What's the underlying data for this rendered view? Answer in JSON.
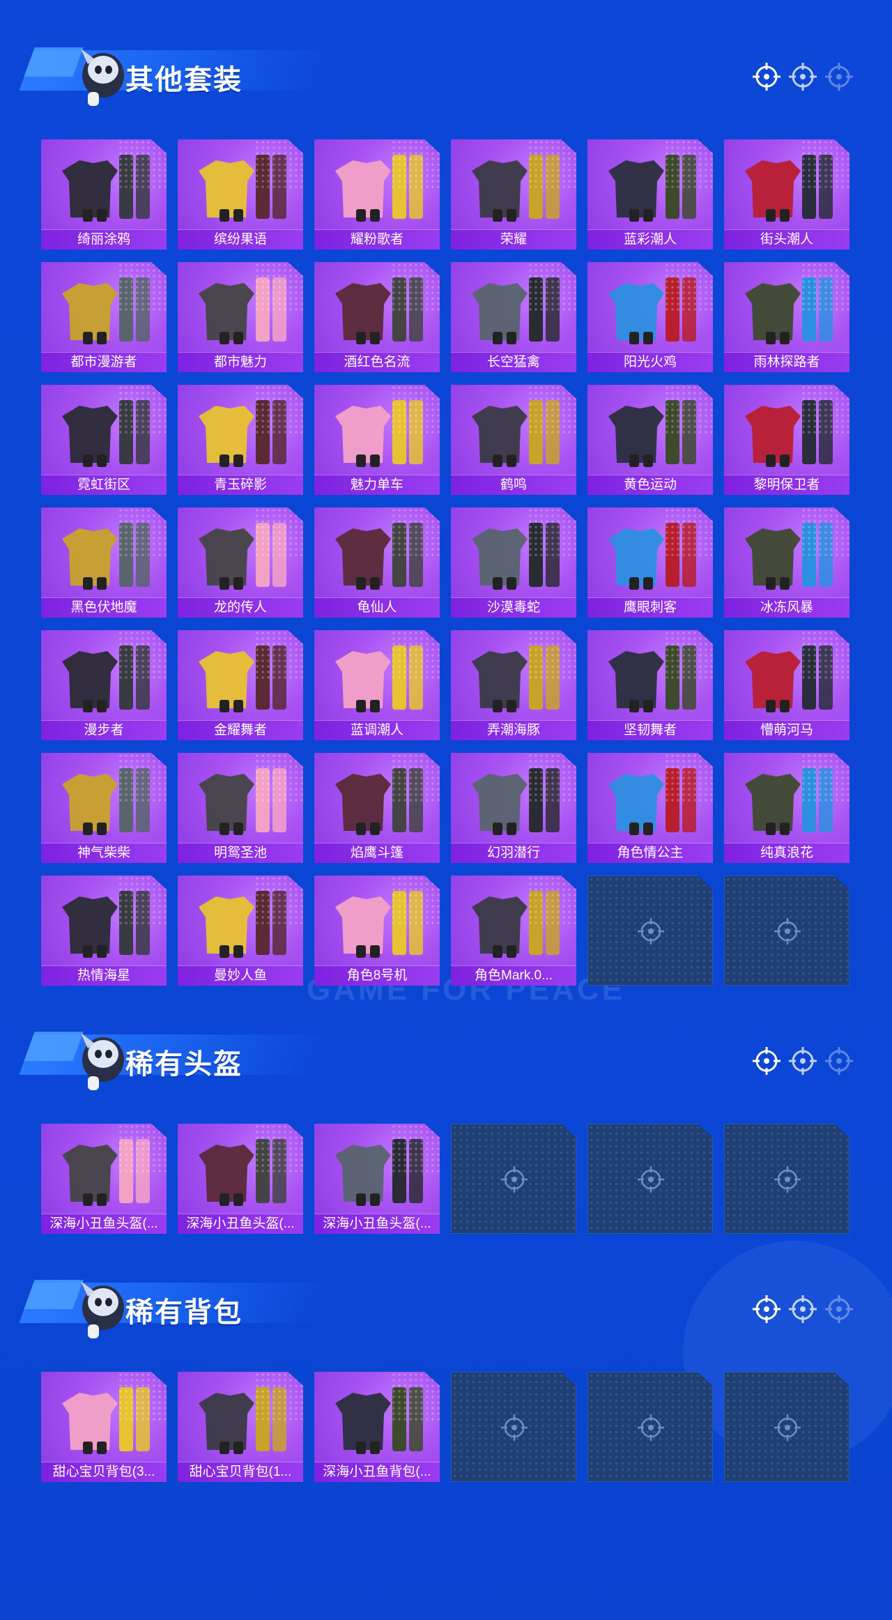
{
  "colors": {
    "background": "#0b46d6",
    "card_purple": "#a44df0",
    "label_bar": "#8a2ee6",
    "empty_slot": "#1f3f74"
  },
  "sections": [
    {
      "title": "其他套装",
      "items": [
        {
          "label": "绮丽涂鸦"
        },
        {
          "label": "缤纷果语"
        },
        {
          "label": "耀粉歌者"
        },
        {
          "label": "荣耀"
        },
        {
          "label": "蓝彩潮人"
        },
        {
          "label": "街头潮人"
        },
        {
          "label": "都市漫游者"
        },
        {
          "label": "都市魅力"
        },
        {
          "label": "酒红色名流"
        },
        {
          "label": "长空猛禽"
        },
        {
          "label": "阳光火鸡"
        },
        {
          "label": "雨林探路者"
        },
        {
          "label": "霓虹街区"
        },
        {
          "label": "青玉碎影"
        },
        {
          "label": "魅力单车"
        },
        {
          "label": "鹤鸣"
        },
        {
          "label": "黄色运动"
        },
        {
          "label": "黎明保卫者"
        },
        {
          "label": "黑色伏地魔"
        },
        {
          "label": "龙的传人"
        },
        {
          "label": "龟仙人"
        },
        {
          "label": "沙漠毒蛇"
        },
        {
          "label": "鹰眼刺客"
        },
        {
          "label": "冰冻风暴"
        },
        {
          "label": "漫步者"
        },
        {
          "label": "金耀舞者"
        },
        {
          "label": "蓝调潮人"
        },
        {
          "label": "弄潮海豚"
        },
        {
          "label": "坚韧舞者"
        },
        {
          "label": "懵萌河马"
        },
        {
          "label": "神气柴柴"
        },
        {
          "label": "明鸳圣池"
        },
        {
          "label": "焰鹰斗篷"
        },
        {
          "label": "幻羽潜行"
        },
        {
          "label": "角色情公主"
        },
        {
          "label": "纯真浪花"
        },
        {
          "label": "热情海星"
        },
        {
          "label": "曼妙人鱼"
        },
        {
          "label": "角色8号机"
        },
        {
          "label": "角色Mark.0..."
        }
      ],
      "empty_slots": 2
    },
    {
      "title": "稀有头盔",
      "items": [
        {
          "label": "深海小丑鱼头盔(..."
        },
        {
          "label": "深海小丑鱼头盔(..."
        },
        {
          "label": "深海小丑鱼头盔(..."
        }
      ],
      "empty_slots": 3
    },
    {
      "title": "稀有背包",
      "items": [
        {
          "label": "甜心宝贝背包(3..."
        },
        {
          "label": "甜心宝贝背包(1..."
        },
        {
          "label": "深海小丑鱼背包(..."
        }
      ],
      "empty_slots": 3
    }
  ],
  "watermark": "GAME FOR PEACE"
}
